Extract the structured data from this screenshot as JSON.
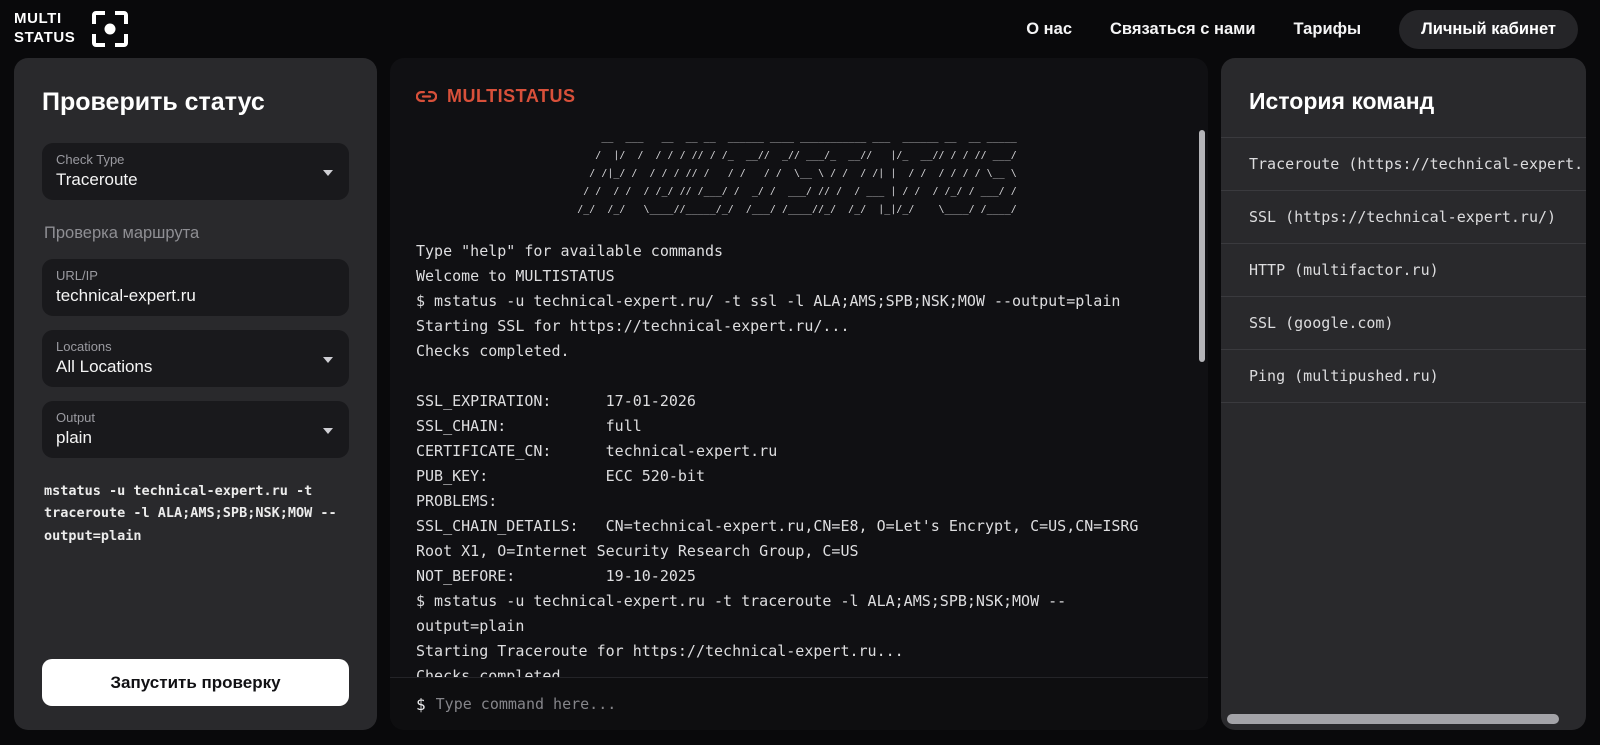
{
  "header": {
    "logo_line1": "MULTI",
    "logo_line2": "STATUS",
    "nav": {
      "about": "О нас",
      "contact": "Связаться с нами",
      "tariffs": "Тарифы",
      "account": "Личный кабинет"
    }
  },
  "check_form": {
    "title": "Проверить статус",
    "check_type": {
      "label": "Check Type",
      "value": "Traceroute"
    },
    "section_label": "Проверка маршрута",
    "url_field": {
      "label": "URL/IP",
      "value": "technical-expert.ru"
    },
    "locations": {
      "label": "Locations",
      "value": "All Locations"
    },
    "output": {
      "label": "Output",
      "value": "plain"
    },
    "command_preview": "mstatus -u technical-expert.ru -t traceroute -l ALA;AMS;SPB;NSK;MOW --output=plain",
    "submit_label": "Запустить проверку"
  },
  "terminal": {
    "title": "MULTISTATUS",
    "accent_color": "#d8503a",
    "ascii_art": "    __  ___   __  __ __  ______ ____ ___________ ___  ______ __  __ _____\n   /  |/  /  / / / // / /_  __//  _// ___/_  __//   |/_  __// / / // ___/\n  / /|_/ /  / / / // /   / /   / /  \\__ \\ / /  / /| |  / /  / / / / \\__ \\\n / /  / /  / /_/ // /___/ /  _/ /  ___/ // /  / ___ | / /  / /_/ / ___/ /\n/_/  /_/   \\____//_____/_/  /___/ /____//_/  /_/  |_|/_/    \\____/ /____/",
    "lines": {
      "0": "Type \"help\" for available commands",
      "1": "Welcome to MULTISTATUS",
      "2": "$ mstatus -u technical-expert.ru/ -t ssl -l ALA;AMS;SPB;NSK;MOW --output=plain",
      "3": "Starting SSL for https://technical-expert.ru/...",
      "4": "Checks completed.",
      "5": "",
      "6": "SSL_EXPIRATION:      17-01-2026",
      "7": "SSL_CHAIN:           full",
      "8": "CERTIFICATE_CN:      technical-expert.ru",
      "9": "PUB_KEY:             ECC 520-bit",
      "10": "PROBLEMS:",
      "11": "SSL_CHAIN_DETAILS:   CN=technical-expert.ru,CN=E8, O=Let's Encrypt, C=US,CN=ISRG Root X1, O=Internet Security Research Group, C=US",
      "12": "NOT_BEFORE:          19-10-2025",
      "13": "$ mstatus -u technical-expert.ru -t traceroute -l ALA;AMS;SPB;NSK;MOW --output=plain",
      "14": "Starting Traceroute for https://technical-expert.ru...",
      "15": "Checks completed."
    },
    "prompt": "$",
    "input_placeholder": "Type command here..."
  },
  "history": {
    "title": "История команд",
    "items": {
      "0": "Traceroute (https://technical-expert.",
      "1": "SSL (https://technical-expert.ru/)",
      "2": "HTTP (multifactor.ru)",
      "3": "SSL (google.com)",
      "4": "Ping (multipushed.ru)"
    }
  },
  "colors": {
    "page_bg": "#09090b",
    "panel_bg": "#29292c",
    "field_bg": "#19191c",
    "terminal_bg": "#101013",
    "accent": "#d8503a",
    "button_bg": "#ffffff",
    "muted_text": "#8e8e93"
  }
}
